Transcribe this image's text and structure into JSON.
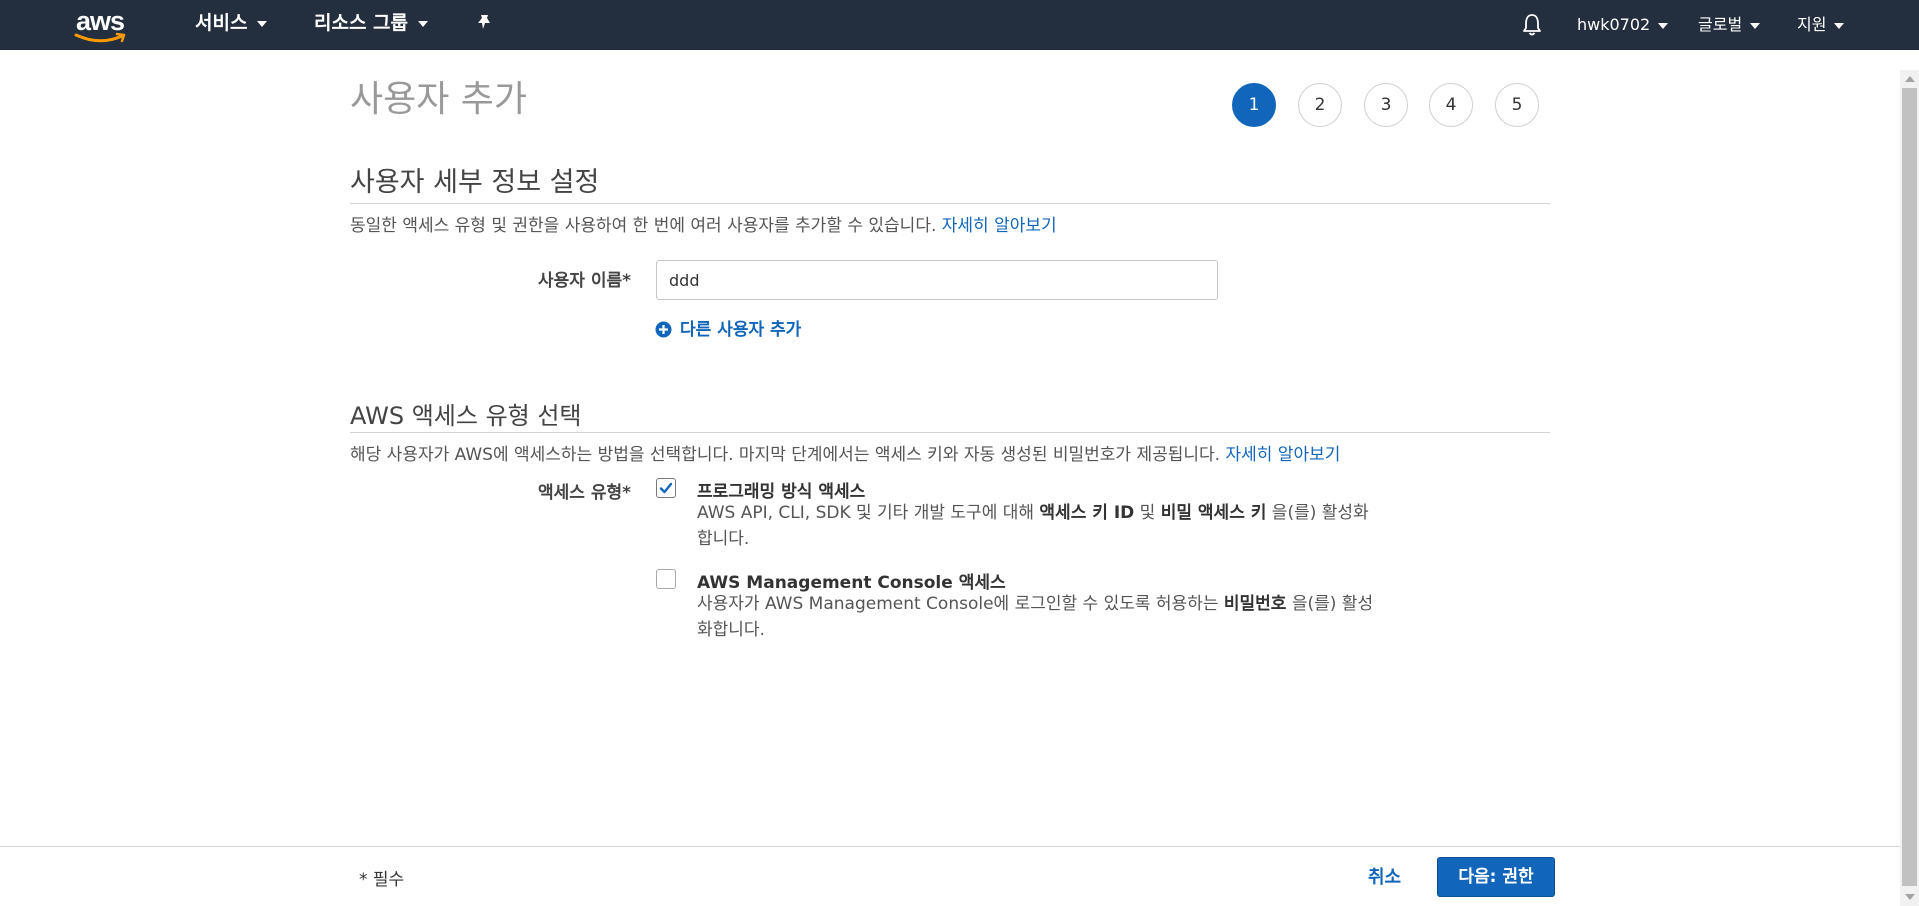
{
  "nav": {
    "logo_text": "aws",
    "services_label": "서비스",
    "resource_groups_label": "리소스 그룹",
    "account_label": "hwk0702",
    "region_label": "글로벌",
    "support_label": "지원"
  },
  "page": {
    "title": "사용자 추가",
    "steps": [
      "1",
      "2",
      "3",
      "4",
      "5"
    ],
    "active_step": 1
  },
  "details_section": {
    "title": "사용자 세부 정보 설정",
    "description": "동일한 액세스 유형 및 권한을 사용하여 한 번에 여러 사용자를 추가할 수 있습니다.",
    "learn_more": "자세히 알아보기",
    "username_label": "사용자 이름*",
    "username_value": "ddd",
    "add_another_user": "다른 사용자 추가"
  },
  "access_section": {
    "title": "AWS 액세스 유형 선택",
    "description": "해당 사용자가 AWS에 액세스하는 방법을 선택합니다. 마지막 단계에서는 액세스 키와 자동 생성된 비밀번호가 제공됩니다.",
    "learn_more": "자세히 알아보기",
    "access_type_label": "액세스 유형*",
    "options": [
      {
        "title": "프로그래밍 방식 액세스",
        "checked": true,
        "desc_part1": "AWS API, CLI, SDK 및 기타 개발 도구에 대해 ",
        "desc_bold1": "액세스 키 ID",
        "desc_part2": " 및 ",
        "desc_bold2": "비밀 액세스 키",
        "desc_part3": " 을(를) 활성화합니다."
      },
      {
        "title": "AWS Management Console 액세스",
        "checked": false,
        "desc_part1": "사용자가 AWS Management Console에 로그인할 수 있도록 허용하는 ",
        "desc_bold1": "비밀번호",
        "desc_part2": " 을(를) 활성화합니다."
      }
    ]
  },
  "footer": {
    "required_note": "* 필수",
    "cancel_label": "취소",
    "next_label": "다음: 권한"
  },
  "colors": {
    "nav_bg": "#232f3e",
    "accent": "#1166bb",
    "aws_orange": "#ff9900"
  }
}
